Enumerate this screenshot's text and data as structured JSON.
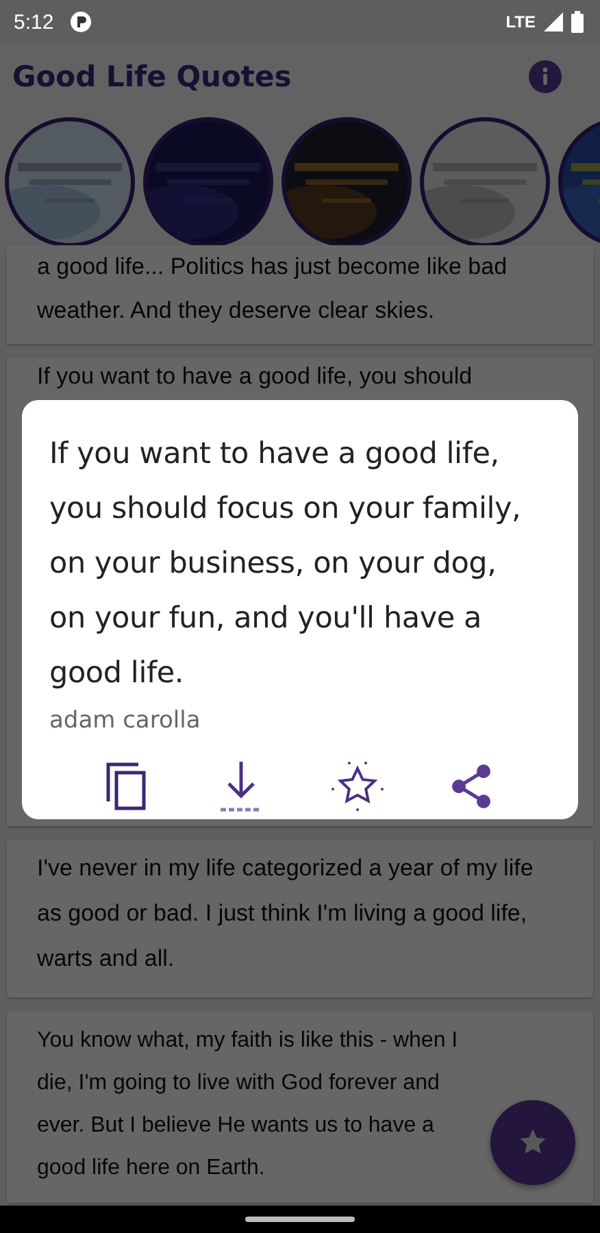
{
  "status_bar": {
    "time": "5:12",
    "network": "LTE"
  },
  "app_bar": {
    "title": "Good Life Quotes"
  },
  "quotes": [
    {
      "text": "a good life... Politics has just become like bad weather. And they deserve clear skies."
    },
    {
      "text": "If you want to have a good life, you should"
    },
    {
      "text": "I've never in my life categorized a year of my life as good or bad. I just think I'm living a good life, warts and all."
    },
    {
      "text": "You know what, my faith is like this - when I die, I'm going to live with God forever and ever. But I believe He wants us to have a good life here on Earth."
    }
  ],
  "dialog": {
    "quote": "If you want to have a good life, you should focus on your family, on your business, on your dog, on your fun, and you'll have a good life.",
    "author": "adam carolla"
  }
}
